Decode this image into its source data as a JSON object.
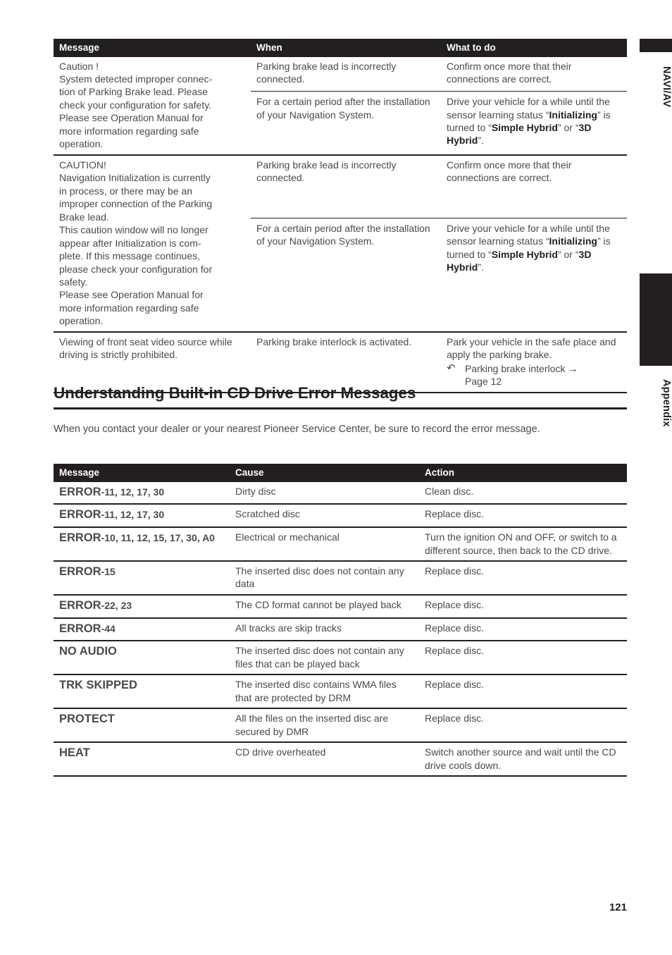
{
  "side_tabs": [
    {
      "label": "NAVI/AV"
    },
    {
      "label": "Appendix"
    }
  ],
  "messages_table": {
    "headers": [
      "Message",
      "When",
      "What to do"
    ],
    "rows": [
      {
        "message": "Caution !\nSystem detected improper connection of Parking Brake lead. Please check your configuration for safety. Please see Operation Manual for more information regarding safe operation.",
        "message_lines": [
          "Caution !",
          "System detected improper connec-",
          "tion of Parking Brake lead. Please",
          "check your configuration for safety.",
          "Please see Operation Manual for",
          "more information regarding safe",
          "operation."
        ],
        "sub_rows": [
          {
            "when": "Parking brake lead is incorrectly connected.",
            "action_prefix": "Confirm once more that their connections are correct.",
            "action_bold_1": "",
            "action_mid": "",
            "action_bold_2": "",
            "action_suffix": ""
          },
          {
            "when": "For a certain period after the installation of your Navigation System.",
            "action_prefix": "Drive your vehicle for a while until the sensor learning status “",
            "action_bold_1": "Initializing",
            "action_mid": "” is turned to “",
            "action_bold_2": "Simple Hybrid",
            "action_mid_2": "” or “",
            "action_bold_3": "3D Hybrid",
            "action_suffix": "”."
          }
        ]
      },
      {
        "message": "CAUTION!\nNavigation Initialization is currently in process, or there may be an improper connection of the Parking Brake lead.\nThis caution window will no longer appear after Initialization is complete.  If this message continues, please check your configuration for safety.\nPlease see Operation Manual for more information regarding safe operation.",
        "message_lines": [
          "CAUTION!",
          "Navigation Initialization is currently",
          "in process, or there may be an",
          "improper connection of the Parking",
          "Brake lead.",
          "This caution window will no longer",
          "appear after Initialization is com-",
          "plete.  If this message continues,",
          "please check your configuration for",
          "safety.",
          "Please see Operation Manual for",
          "more information regarding safe",
          "operation."
        ],
        "sub_rows": [
          {
            "when": "Parking brake lead is incorrectly connected.",
            "action_prefix": "Confirm once more that their connections are correct."
          },
          {
            "when": "For a certain period after the installation of your Navigation System.",
            "action_prefix": "Drive your vehicle for a while until the sensor learning status “",
            "action_bold_1": "Initializing",
            "action_mid": "” is turned to “",
            "action_bold_2": "Simple Hybrid",
            "action_mid_2": "” or “",
            "action_bold_3": "3D Hybrid",
            "action_suffix": "”."
          }
        ]
      },
      {
        "message": "Viewing of front seat video source while driving is strictly prohibited.",
        "when": "Parking brake interlock is activated.",
        "action_prefix": "Park your vehicle in the safe place and apply the parking brake.",
        "reference_glyph": "↷",
        "reference_text": "Parking brake interlock",
        "reference_arrow": "→",
        "reference_page": "Page 12"
      }
    ]
  },
  "section": {
    "heading": "Understanding Built-in CD Drive Error Messages",
    "intro": "When you contact your dealer or your nearest Pioneer Service Center, be sure to record the error message."
  },
  "cd_error_table": {
    "headers": [
      "Message",
      "Cause",
      "Action"
    ],
    "rows": [
      {
        "code_bold": "ERROR",
        "code_rest": "-11, 12, 17, 30",
        "cause": "Dirty disc",
        "action": "Clean disc."
      },
      {
        "code_bold": "ERROR",
        "code_rest": "-11, 12, 17, 30",
        "cause": "Scratched disc",
        "action": "Replace disc."
      },
      {
        "code_bold": "ERROR",
        "code_rest": "-10, 11, 12, 15, 17, 30, A0",
        "cause": "Electrical or mechanical",
        "action": "Turn the ignition ON and OFF, or switch to a different source, then back to the CD drive."
      },
      {
        "code_bold": "ERROR",
        "code_rest": "-15",
        "cause": "The inserted disc does not contain any data",
        "action": "Replace disc."
      },
      {
        "code_bold": "ERROR",
        "code_rest": "-22, 23",
        "cause": "The CD format cannot be played back",
        "action": "Replace disc."
      },
      {
        "code_bold": "ERROR",
        "code_rest": "-44",
        "cause": "All tracks are skip tracks",
        "action": "Replace disc."
      },
      {
        "code_bold": "NO AUDIO",
        "code_rest": "",
        "cause": "The inserted disc does not contain any files that can be played back",
        "action": "Replace disc."
      },
      {
        "code_bold": "TRK SKIPPED",
        "code_rest": "",
        "cause": "The inserted disc contains WMA files that are protected by DRM",
        "action": "Replace disc."
      },
      {
        "code_bold": "PROTECT",
        "code_rest": "",
        "cause": "All the files on the inserted disc are secured by DMR",
        "action": "Replace disc."
      },
      {
        "code_bold": "HEAT",
        "code_rest": "",
        "cause": "CD drive overheated",
        "action": "Switch another source and wait until the CD drive cools down."
      }
    ]
  },
  "page_number": "121",
  "colors": {
    "ink": "#231f20",
    "body_text": "#4a4a4a",
    "header_bar": "#231f20",
    "page_background": "#ffffff"
  }
}
